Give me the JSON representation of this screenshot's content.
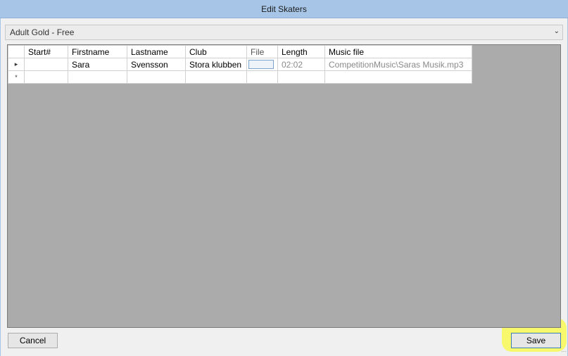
{
  "window": {
    "title": "Edit Skaters"
  },
  "category_select": {
    "value": "Adult Gold - Free",
    "arrow_icon": "chevron-down-icon"
  },
  "grid": {
    "columns": [
      "Start#",
      "Firstname",
      "Lastname",
      "Club",
      "File",
      "Length",
      "Music file"
    ],
    "rows": [
      {
        "marker": "▸",
        "start": "",
        "firstname": "Sara",
        "lastname": "Svensson",
        "club": "Stora klubben",
        "file": "",
        "length": "02:02",
        "music_file": "CompetitionMusic\\Saras Musik.mp3"
      }
    ],
    "new_row_marker": "*"
  },
  "buttons": {
    "cancel": "Cancel",
    "save": "Save"
  }
}
